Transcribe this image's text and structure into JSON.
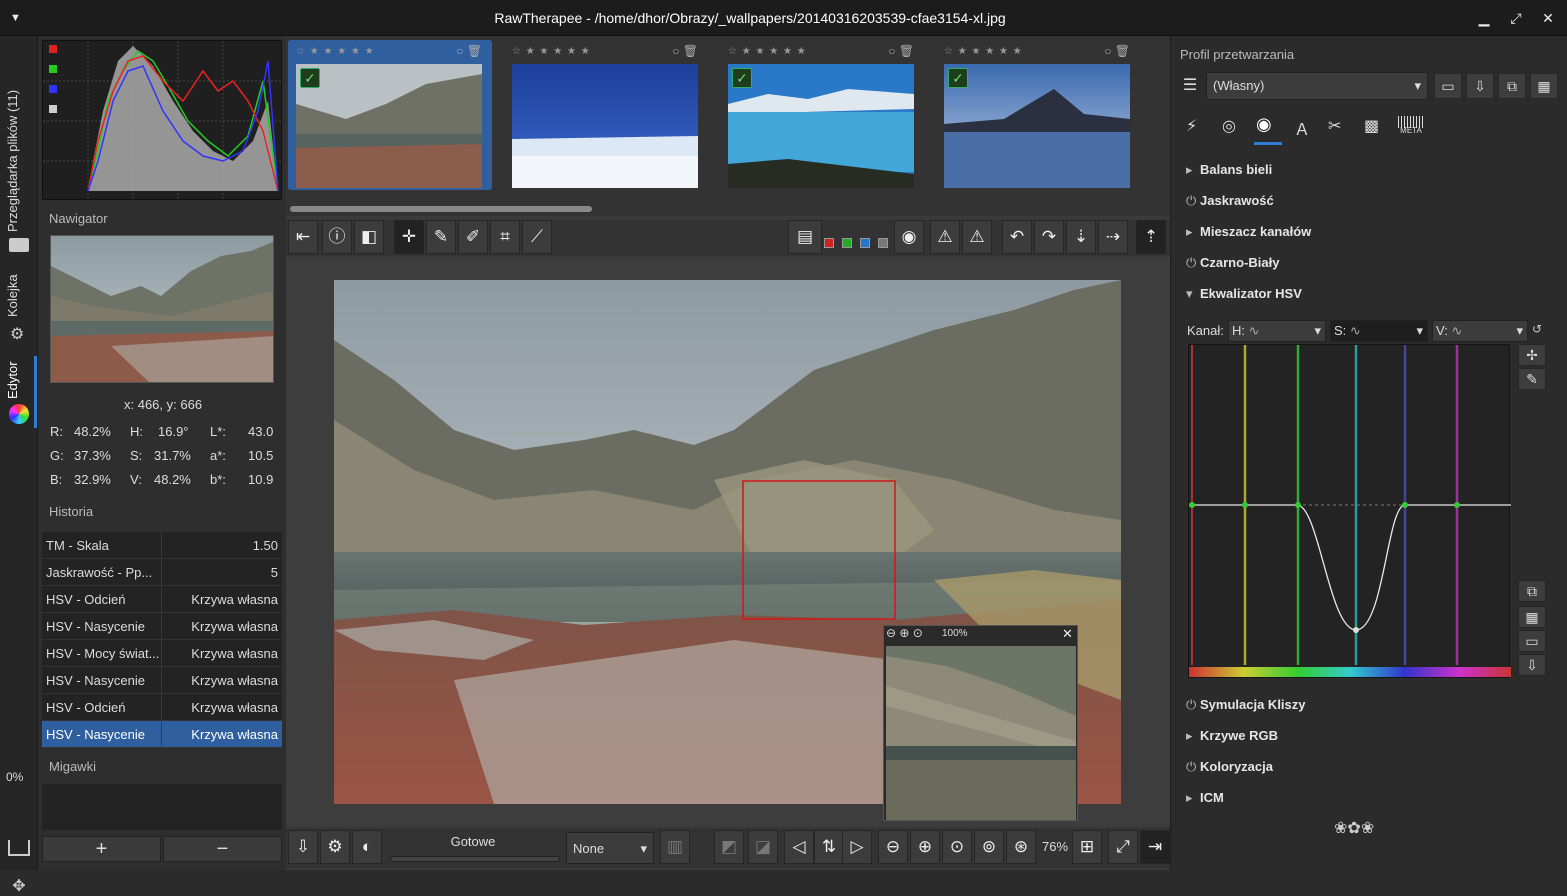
{
  "window": {
    "title": "RawTherapee  -  /home/dhor/Obrazy/_wallpapers/20140316203539-cfae3154-xl.jpg",
    "menu_icon": "triangle-down-icon"
  },
  "sidebar": {
    "tabs": [
      {
        "label": "Przeglądarka plików (11)",
        "icon": "folder-icon"
      },
      {
        "label": "Kolejka",
        "icon": "gear-icon"
      },
      {
        "label": "Edytor",
        "icon": "color-wheel-icon"
      }
    ],
    "progress": "0%"
  },
  "left": {
    "navigator_title": "Nawigator",
    "coords": "x: 466, y: 666",
    "values": {
      "r": "R:",
      "r_val": "48.2%",
      "h": "H:",
      "h_val": "16.9°",
      "l": "L*:",
      "l_val": "43.0",
      "g": "G:",
      "g_val": "37.3%",
      "s": "S:",
      "s_val": "31.7%",
      "a": "a*:",
      "a_val": "10.5",
      "b": "B:",
      "b_val": "32.9%",
      "v": "V:",
      "v_val": "48.2%",
      "bb": "b*:",
      "bb_val": "10.9"
    },
    "history_title": "Historia",
    "history": [
      {
        "a": "TM - Skala",
        "b": "1.50"
      },
      {
        "a": "Jaskrawość - Pp...",
        "b": "5"
      },
      {
        "a": "HSV - Odcień",
        "b": "Krzywa własna"
      },
      {
        "a": "HSV - Nasycenie",
        "b": "Krzywa własna"
      },
      {
        "a": "HSV - Mocy świat...",
        "b": "Krzywa własna"
      },
      {
        "a": "HSV - Nasycenie",
        "b": "Krzywa własna"
      },
      {
        "a": "HSV - Odcień",
        "b": "Krzywa własna"
      },
      {
        "a": "HSV - Nasycenie",
        "b": "Krzywa własna"
      }
    ],
    "snapshots_title": "Migawki",
    "add": "+",
    "remove": "−"
  },
  "film": {
    "stars": "☆ ★ ★ ★ ★ ★"
  },
  "bottom": {
    "status": "Gotowe",
    "select": "None",
    "zoom": "76%"
  },
  "detail": {
    "zoom": "100%"
  },
  "right": {
    "title": "Profil przetwarzania",
    "profile": "(Własny)",
    "tools": [
      {
        "label": "Balans bieli",
        "icon": "▸"
      },
      {
        "label": "Jaskrawość",
        "icon": "⏻"
      },
      {
        "label": "Mieszacz kanałów",
        "icon": "▸"
      },
      {
        "label": "Czarno-Biały",
        "icon": "⏻"
      },
      {
        "label": "Ekwalizator HSV",
        "icon": "▾"
      }
    ],
    "tools2": [
      {
        "label": "Symulacja Kliszy",
        "icon": "⏻"
      },
      {
        "label": "Krzywe RGB",
        "icon": "▸"
      },
      {
        "label": "Koloryzacja",
        "icon": "⏻"
      },
      {
        "label": "ICM",
        "icon": "▸"
      }
    ],
    "channel": "Kanał:",
    "h": "H:",
    "s": "S:",
    "v": "V:",
    "meta": "META",
    "ornament": "❀✿❀"
  }
}
